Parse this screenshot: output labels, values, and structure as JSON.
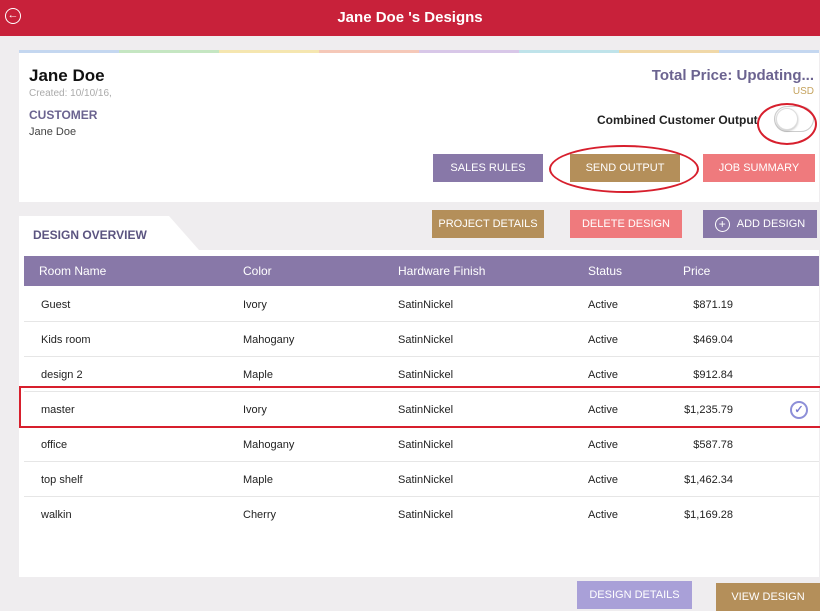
{
  "header": {
    "title": "Jane Doe 's Designs",
    "back_icon": "back-arrow-icon"
  },
  "customer": {
    "name": "Jane Doe",
    "created": "Created: 10/10/16,",
    "label": "CUSTOMER",
    "value": "Jane Doe"
  },
  "pricing": {
    "total": "Total Price: Updating...",
    "currency": "USD",
    "combined_output_label": "Combined Customer Output",
    "combined_output_on": false
  },
  "actions": {
    "sales_rules": "SALES RULES",
    "send_output": "SEND OUTPUT",
    "job_summary": "JOB SUMMARY"
  },
  "overview": {
    "tab_label": "DESIGN OVERVIEW",
    "project_details": "PROJECT DETAILS",
    "delete_design": "DELETE DESIGN",
    "add_design": "ADD DESIGN"
  },
  "table": {
    "columns": [
      "Room Name",
      "Color",
      "Hardware Finish",
      "Status",
      "Price"
    ],
    "rows": [
      {
        "room": "Guest",
        "color": "Ivory",
        "hardware": "SatinNickel",
        "status": "Active",
        "price": "$871.19",
        "selected": false
      },
      {
        "room": "Kids room",
        "color": "Mahogany",
        "hardware": "SatinNickel",
        "status": "Active",
        "price": "$469.04",
        "selected": false
      },
      {
        "room": "design 2",
        "color": "Maple",
        "hardware": "SatinNickel",
        "status": "Active",
        "price": "$912.84",
        "selected": false
      },
      {
        "room": "master",
        "color": "Ivory",
        "hardware": "SatinNickel",
        "status": "Active",
        "price": "$1,235.79",
        "selected": true
      },
      {
        "room": "office",
        "color": "Mahogany",
        "hardware": "SatinNickel",
        "status": "Active",
        "price": "$587.78",
        "selected": false
      },
      {
        "room": "top shelf",
        "color": "Maple",
        "hardware": "SatinNickel",
        "status": "Active",
        "price": "$1,462.34",
        "selected": false
      },
      {
        "room": "walkin",
        "color": "Cherry",
        "hardware": "SatinNickel",
        "status": "Active",
        "price": "$1,169.28",
        "selected": false
      }
    ]
  },
  "footer": {
    "design_details": "DESIGN DETAILS",
    "view_design": "VIEW DESIGN"
  },
  "colors": {
    "brand_red": "#c8213a",
    "purple": "#8878a8",
    "gold": "#b48f5a",
    "salmon": "#ef7a7d",
    "rainbow": [
      "#c4d7f0",
      "#c5e6c2",
      "#f5e6b0",
      "#f5c8b8",
      "#d8c7e8",
      "#bfe3ea",
      "#f0d8a8",
      "#c4d7f0"
    ]
  }
}
